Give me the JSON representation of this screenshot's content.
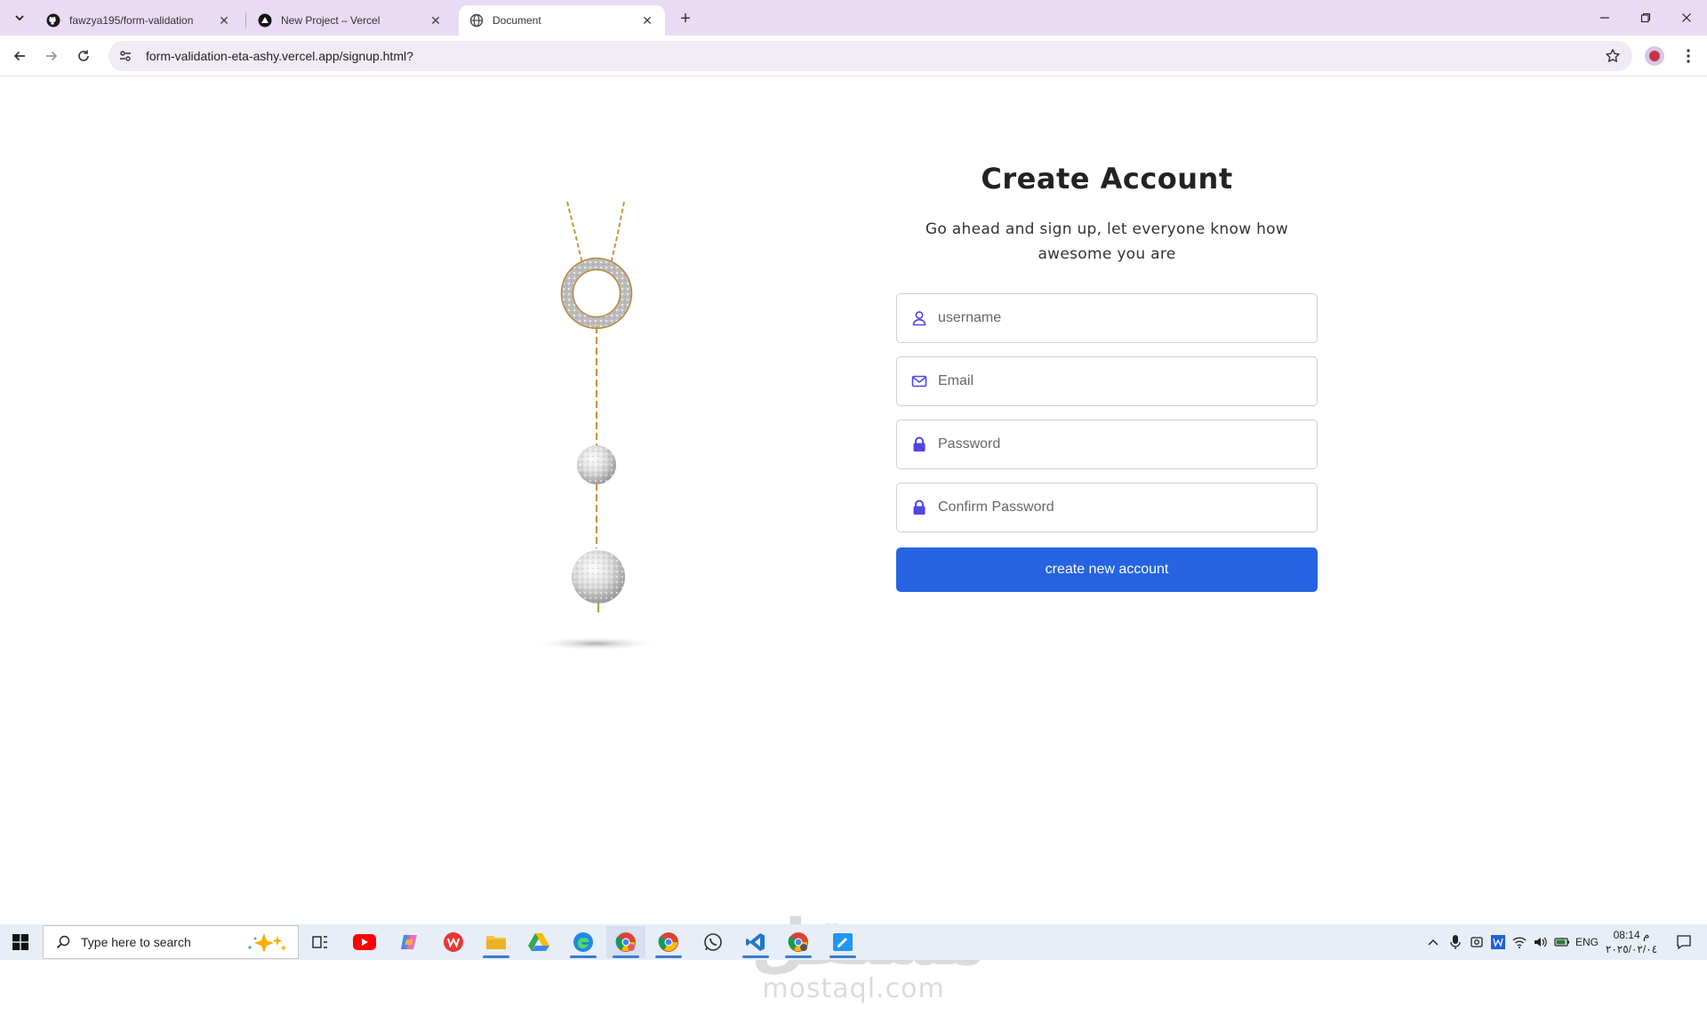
{
  "browser": {
    "tabs": [
      {
        "title": "fawzya195/form-validation",
        "favicon": "github-icon",
        "active": false
      },
      {
        "title": "New Project – Vercel",
        "favicon": "vercel-icon",
        "active": false
      },
      {
        "title": "Document",
        "favicon": "globe-icon",
        "active": true
      }
    ],
    "url": "form-validation-eta-ashy.vercel.app/signup.html?"
  },
  "form": {
    "title": "Create Account",
    "subtitle": "Go ahead and sign up, let everyone know how awesome you are",
    "username_placeholder": "username",
    "email_placeholder": "Email",
    "password_placeholder": "Password",
    "confirm_placeholder": "Confirm Password",
    "submit_label": "create new account",
    "accent_color": "#2563e0",
    "icon_color": "#4f46e5"
  },
  "watermark": {
    "arabic": "مستقل",
    "latin": "mostaql.com"
  },
  "taskbar": {
    "search_placeholder": "Type here to search",
    "language": "ENG",
    "time": "08:14 م",
    "date": "٢٠٢٥/٠٢/٠٤"
  }
}
